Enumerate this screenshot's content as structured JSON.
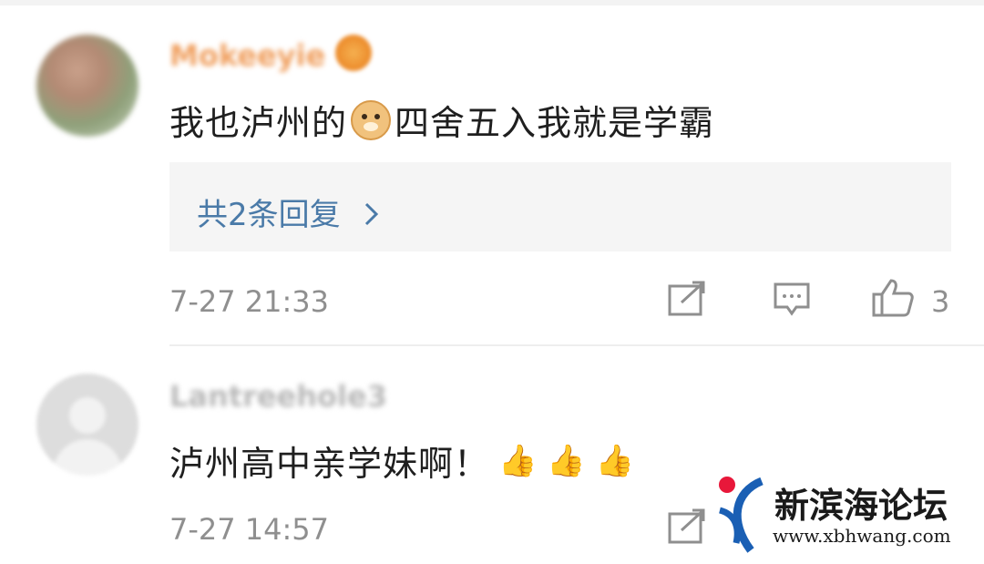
{
  "comments": [
    {
      "username": "Mokeeyie",
      "text_before_emoji": "我也泸州的",
      "emoji": "doge-emoji",
      "text_after_emoji": "四舍五入我就是学霸",
      "replies_label": "共2条回复",
      "time": "7-27 21:33",
      "like_count": "3"
    },
    {
      "username": "Lantreehole3",
      "text": "泸州高中亲学妹啊！",
      "emojis": [
        "👍",
        "👍",
        "👍"
      ],
      "time": "7-27 14:57"
    }
  ],
  "icons": {
    "repost": "share-edit-icon",
    "comment": "comment-bubble-icon",
    "like": "thumbs-up-icon",
    "reply_chevron": "chevron-right-icon"
  },
  "colors": {
    "link": "#4a7aa8",
    "meta_text": "#8f8f8f",
    "reply_bg": "#f5f5f5",
    "watermark_red": "#e8173a",
    "watermark_blue": "#1a5fb4"
  },
  "watermark": {
    "title": "新滨海论坛",
    "url": "www.xbhwang.com"
  }
}
